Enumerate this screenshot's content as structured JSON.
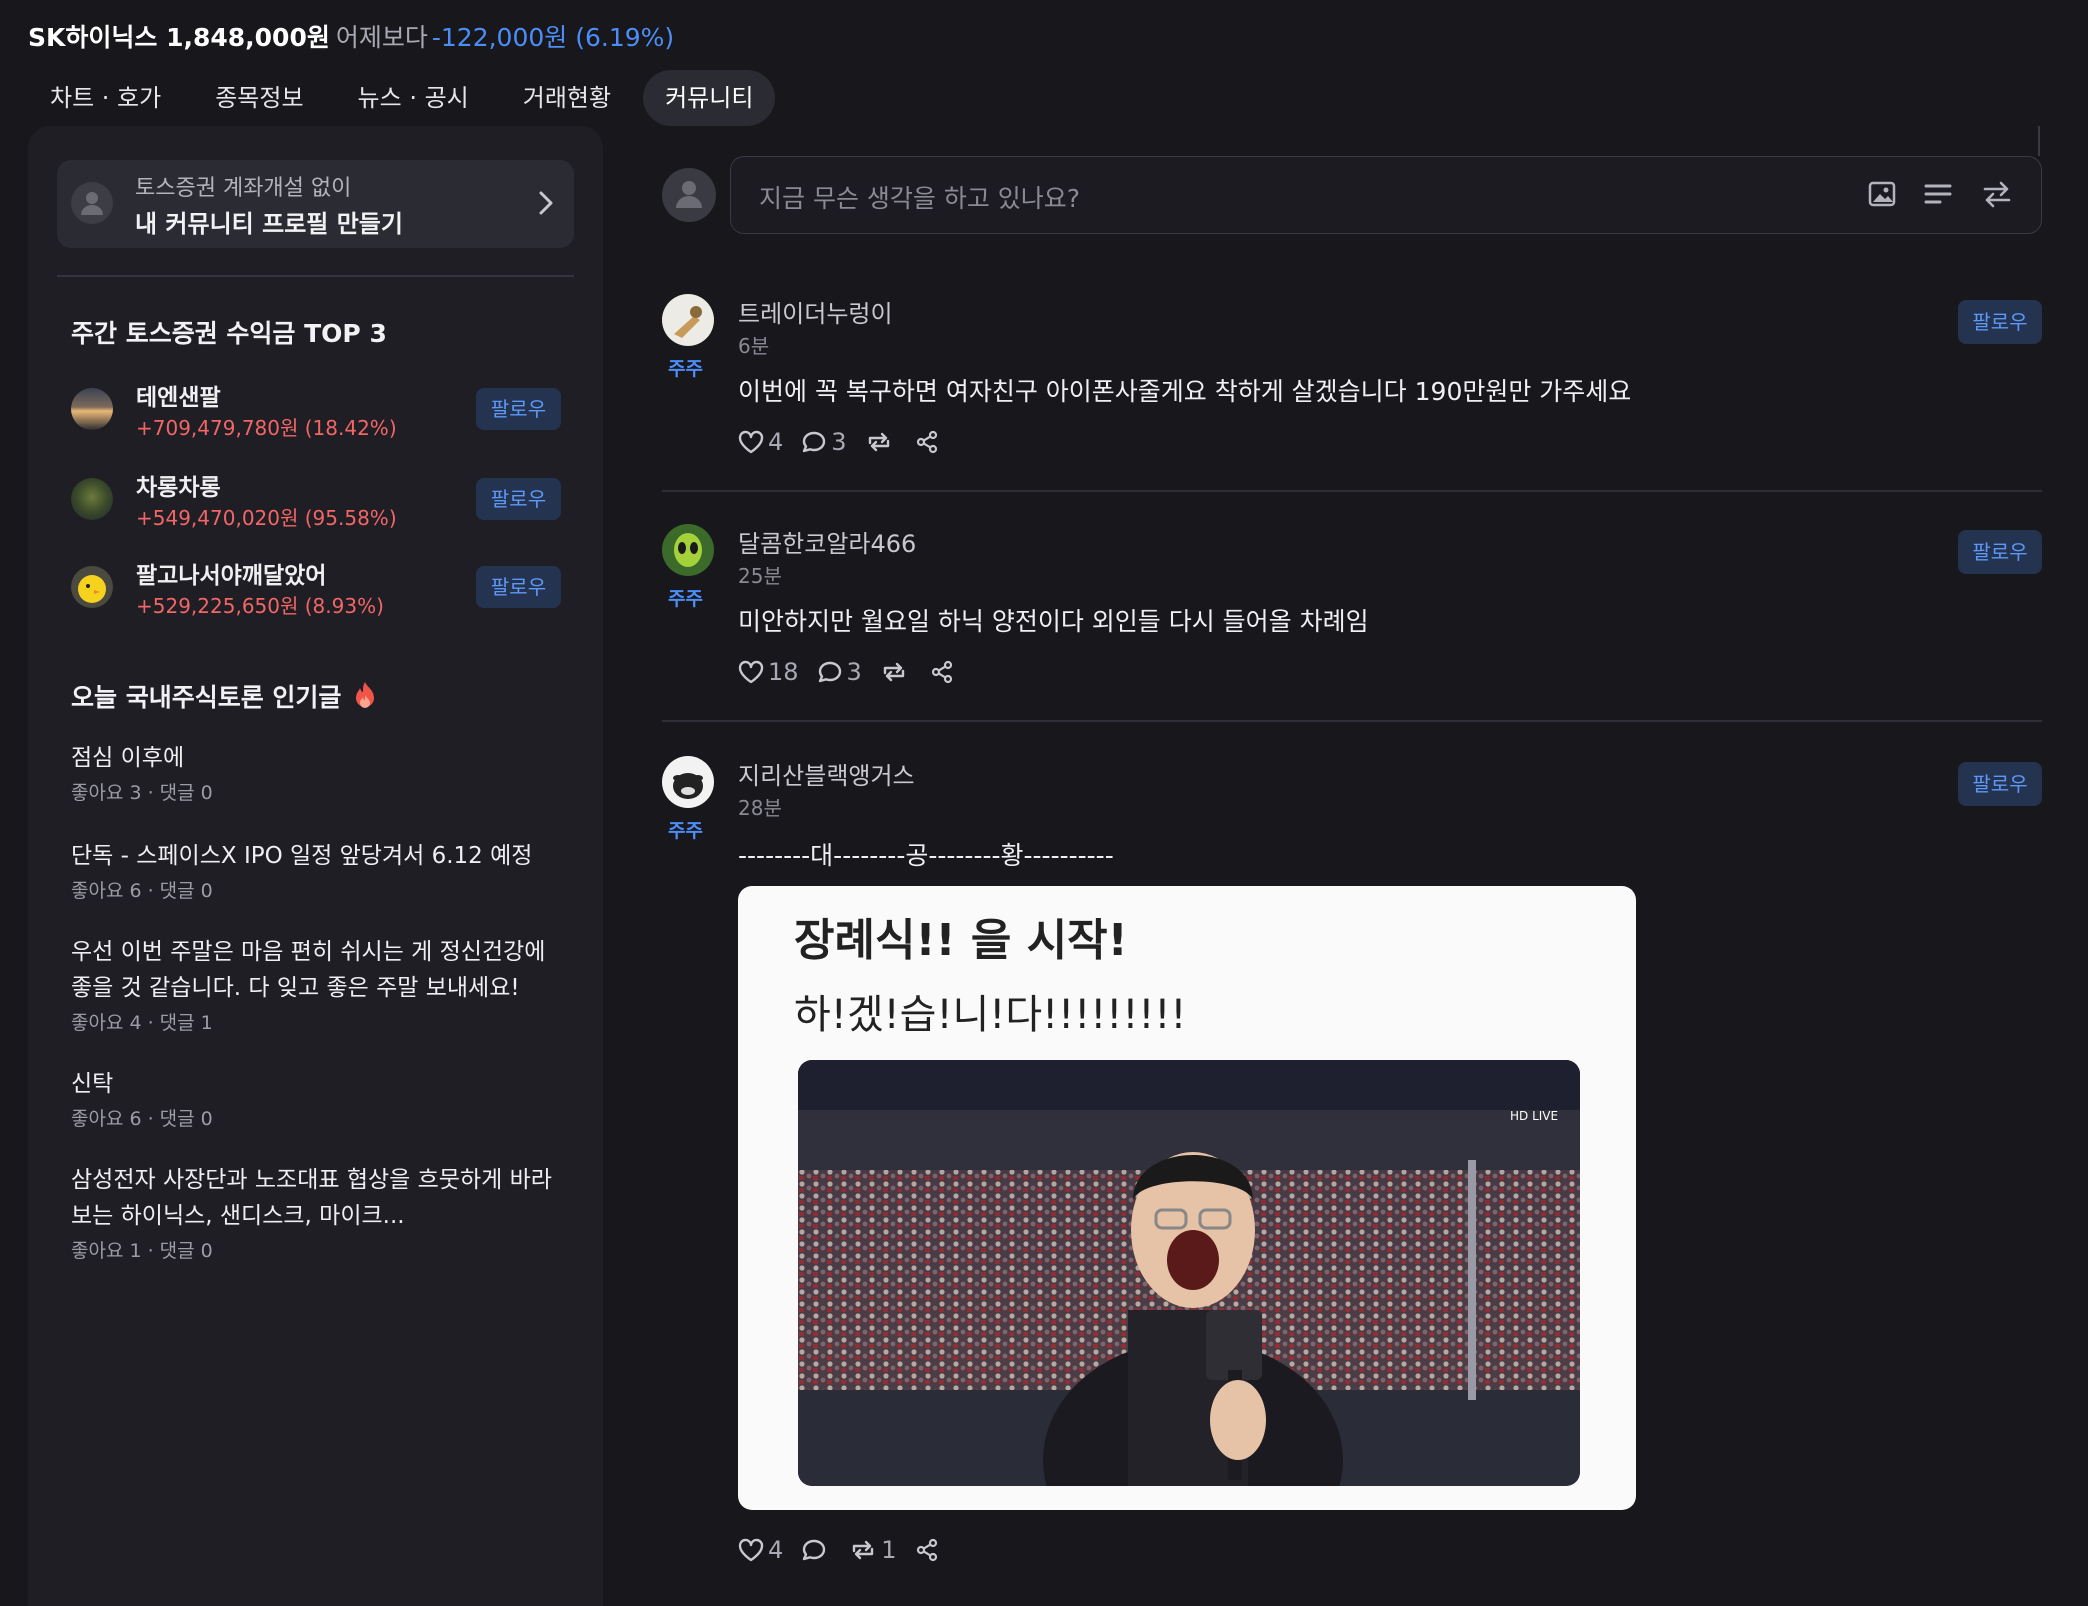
{
  "header": {
    "stock_name": "SK하이닉스 1,848,000원",
    "vs_label": "어제보다",
    "change": "-122,000원 (6.19%)"
  },
  "tabs": [
    {
      "label": "차트 · 호가"
    },
    {
      "label": "종목정보"
    },
    {
      "label": "뉴스 · 공시"
    },
    {
      "label": "거래현황"
    },
    {
      "label": "커뮤니티"
    }
  ],
  "sidebar": {
    "promo": {
      "line1": "토스증권 계좌개설 없이",
      "line2": "내 커뮤니티 프로필 만들기"
    },
    "top3_title": "주간 토스증권 수익금 TOP 3",
    "top3": [
      {
        "name": "테엔샌팔",
        "profit": "+709,479,780원 (18.42%)",
        "follow": "팔로우"
      },
      {
        "name": "차롱차롱",
        "profit": "+549,470,020원 (95.58%)",
        "follow": "팔로우"
      },
      {
        "name": "팔고나서야깨달았어",
        "profit": "+529,225,650원 (8.93%)",
        "follow": "팔로우"
      }
    ],
    "popular_title": "오늘 국내주식토론 인기글",
    "popular": [
      {
        "title": "점심 이후에",
        "meta": "좋아요 3 · 댓글 0"
      },
      {
        "title": "단독 - 스페이스X IPO 일정 앞당겨서 6.12 예정",
        "meta": "좋아요 6 · 댓글 0"
      },
      {
        "title": "우선 이번 주말은 마음 편히 쉬시는 게 정신건강에 좋을 것 같습니다. 다 잊고 좋은 주말 보내세요!",
        "meta": "좋아요 4 · 댓글 1"
      },
      {
        "title": "신탁",
        "meta": "좋아요 6 · 댓글 0"
      },
      {
        "title": "삼성전자 사장단과 노조대표 협상을 흐뭇하게 바라보는 하이닉스, 샌디스크, 마이크...",
        "meta": "좋아요 1 · 댓글 0"
      }
    ]
  },
  "compose": {
    "placeholder": "지금 무슨 생각을 하고 있나요?"
  },
  "posts": [
    {
      "author": "트레이더누렁이",
      "time": "6분",
      "badge": "주주",
      "follow": "팔로우",
      "text": "이번에 꼭 복구하면 여자친구 아이폰사줄게요 착하게 살겠습니다 190만원만 가주세요",
      "likes": "4",
      "comments": "3",
      "reposts": ""
    },
    {
      "author": "달콤한코알라466",
      "time": "25분",
      "badge": "주주",
      "follow": "팔로우",
      "text": "미안하지만 월요일 하닉 양전이다 외인들 다시 들어올 차례임",
      "likes": "18",
      "comments": "3",
      "reposts": ""
    },
    {
      "author": "지리산블랙앵거스",
      "time": "28분",
      "badge": "주주",
      "follow": "팔로우",
      "text": "--------대--------공--------황----------",
      "likes": "4",
      "comments": "",
      "reposts": "1",
      "card": {
        "headline": "장례식!! 을 시작!",
        "subline": "하!겠!습!니!다!!!!!!!!!"
      }
    }
  ],
  "colors": {
    "background": "#17171c",
    "panel": "#1e1e24",
    "accent_blue": "#4d8df7",
    "profit_red": "#f26666"
  }
}
